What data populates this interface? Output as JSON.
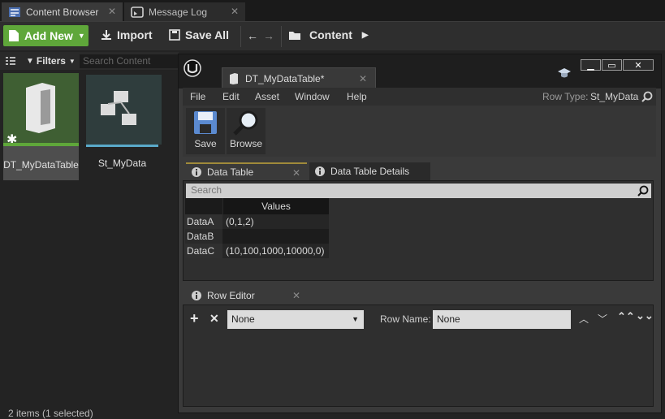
{
  "tabs": [
    {
      "label": "Content Browser",
      "icon": "content-browser-icon"
    },
    {
      "label": "Message Log",
      "icon": "message-log-icon"
    }
  ],
  "toolbar": {
    "add_new_label": "Add New",
    "import_label": "Import",
    "save_all_label": "Save All",
    "path": "Content"
  },
  "content_browser": {
    "filters_label": "Filters",
    "search_placeholder": "Search Content",
    "assets": [
      {
        "label": "DT_MyDataTable",
        "selected": true
      },
      {
        "label": "St_MyData",
        "selected": false
      }
    ],
    "status": "2 items (1 selected)"
  },
  "editor": {
    "asset_tab_label": "DT_MyDataTable*",
    "menu": [
      "File",
      "Edit",
      "Asset",
      "Window",
      "Help"
    ],
    "row_type_label": "Row Type:",
    "row_type_value": "St_MyData",
    "save_label": "Save",
    "browse_label": "Browse",
    "data_table_tab": "Data Table",
    "details_tab": "Data Table Details",
    "search_placeholder": "Search",
    "table": {
      "header": "Values",
      "rows": [
        {
          "name": "DataA",
          "value": "(0,1,2)"
        },
        {
          "name": "DataB",
          "value": ""
        },
        {
          "name": "DataC",
          "value": "(10,100,1000,10000,0)"
        }
      ]
    },
    "row_editor_tab": "Row Editor",
    "row_editor": {
      "struct_select": "None",
      "row_name_label": "Row Name:",
      "row_name_value": "None"
    }
  },
  "colors": {
    "accent_green": "#5fa73a",
    "selected_asset_bg": "#4a6a3a",
    "struct_accent": "#5aa9c9"
  }
}
